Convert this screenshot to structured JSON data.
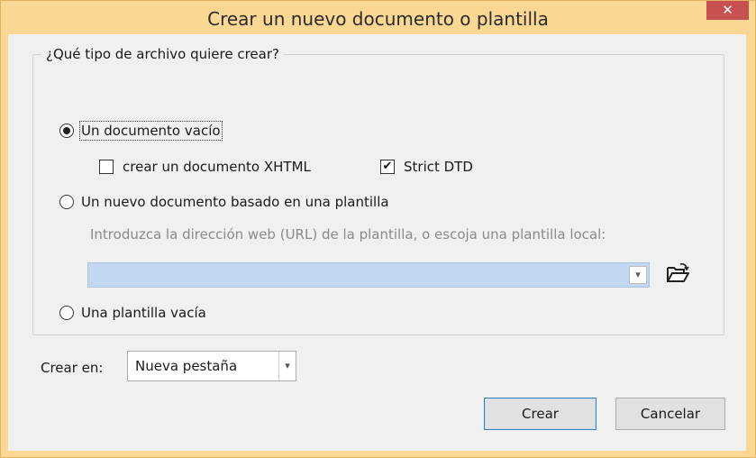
{
  "window": {
    "title": "Crear un nuevo documento o plantilla",
    "close_label": "✕"
  },
  "file_type_group": {
    "legend": "¿Qué tipo de archivo quiere crear?",
    "options": [
      {
        "label": "Un documento vacío",
        "selected": true
      },
      {
        "label": "Un nuevo documento basado en una plantilla",
        "selected": false
      },
      {
        "label": "Una plantilla vacía",
        "selected": false
      }
    ],
    "xhtml_checkbox": {
      "label": "crear un documento XHTML",
      "checked": false
    },
    "strict_dtd_checkbox": {
      "label": "Strict DTD",
      "checked": true,
      "mark": "✔"
    },
    "template_hint": "Introduzca la dirección web (URL) de la plantilla, o escoja una plantilla local:",
    "template_url": {
      "value": "",
      "dropdown_arrow": "▾"
    },
    "folder_icon": "open-folder-icon"
  },
  "create_in": {
    "label": "Crear en:",
    "selected": "Nueva pestaña",
    "dropdown_arrow": "▾"
  },
  "buttons": {
    "create": "Crear",
    "cancel": "Cancelar"
  },
  "colors": {
    "title_bar": "#fad894",
    "close_button": "#c75050",
    "url_field": "#c2d8f0",
    "dialog_body": "#f0f0f0"
  }
}
